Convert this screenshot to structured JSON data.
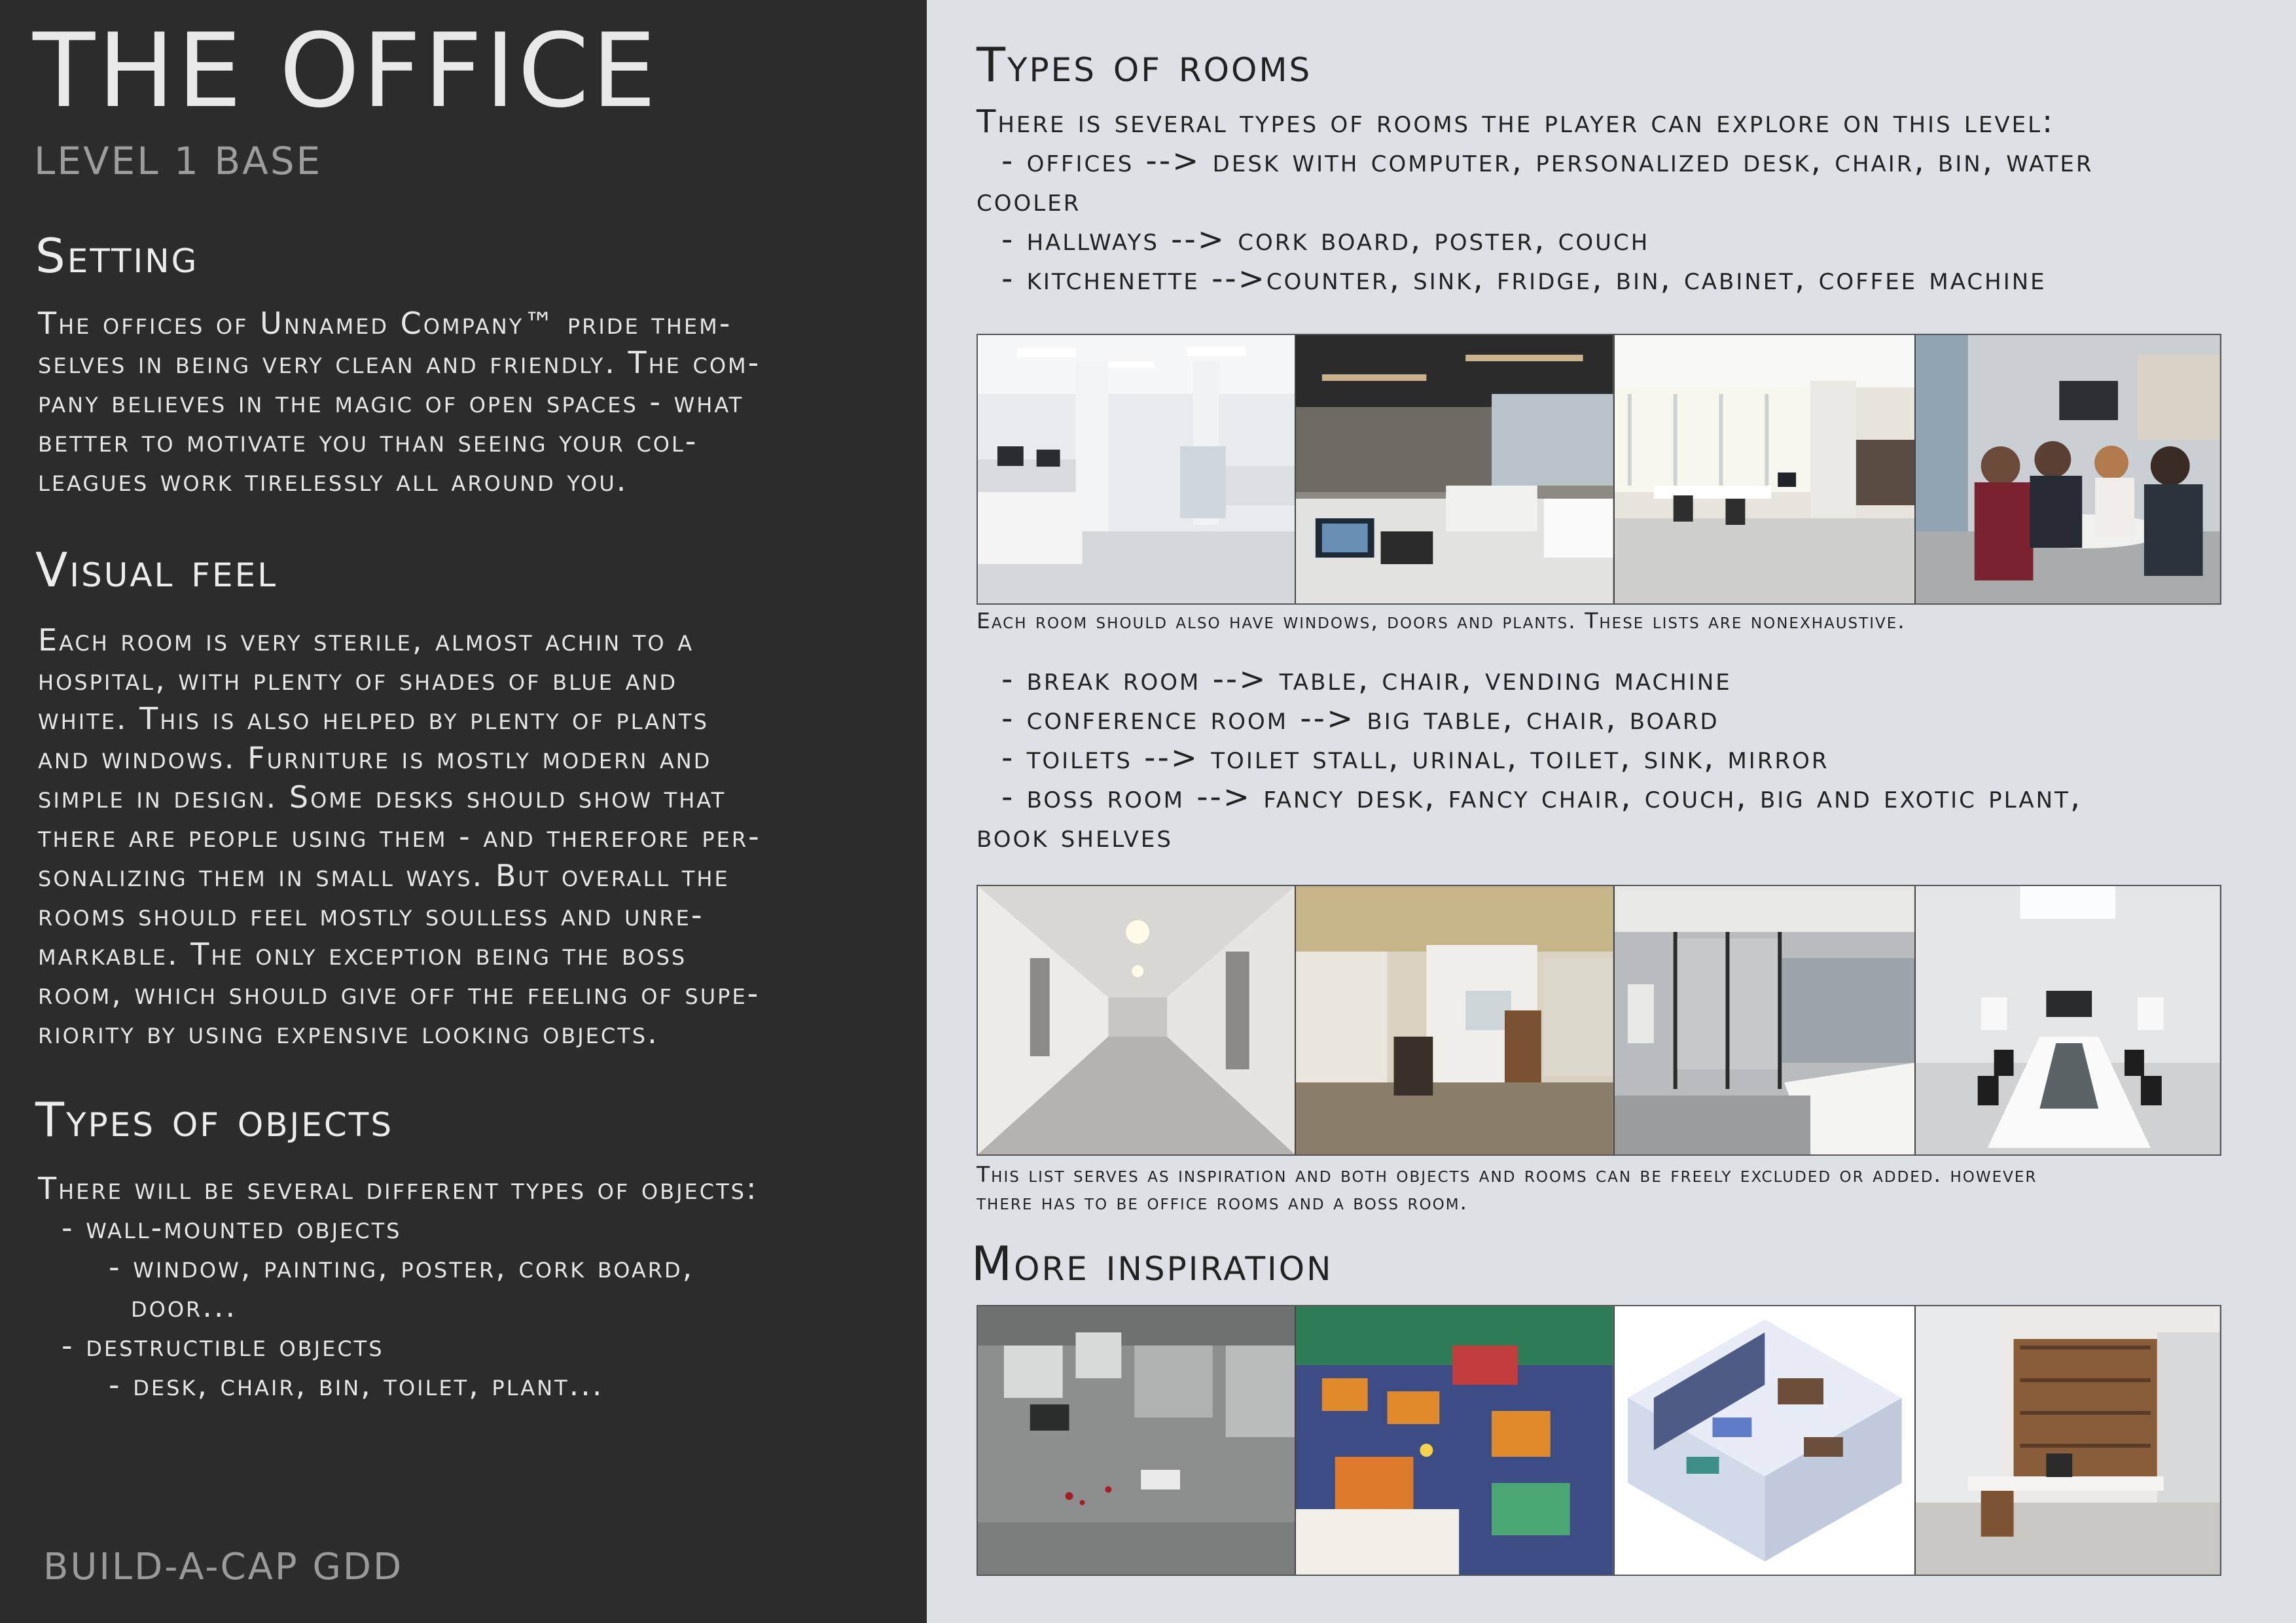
{
  "left": {
    "title": "THE OFFICE",
    "subtitle": "LEVEL 1 BASE",
    "setting": {
      "heading": "Setting",
      "lines": [
        "The offices of Unnamed Company™ pride them-",
        "selves in being very clean and friendly. The com-",
        "pany believes in the magic of open spaces - what",
        "better to motivate you than seeing your col-",
        "leagues work tirelessly all around you."
      ]
    },
    "visual": {
      "heading": "Visual feel",
      "lines": [
        "Each room is very sterile, almost achin to a",
        "hospital, with plenty of shades of blue and",
        "white. This is also helped by plenty of plants",
        "and windows. Furniture is mostly modern and",
        "simple in design. Some desks should show that",
        "there are people using them - and therefore per-",
        "sonalizing them in small ways. But overall the",
        "rooms should feel mostly soulless and unre-",
        "markable. The only exception being the boss",
        "room, which should give off the feeling of supe-",
        "riority by using expensive looking objects."
      ]
    },
    "objects": {
      "heading": "Types of objects",
      "intro": "There will be several different types of objects:",
      "wall_head": "- wall-mounted objects",
      "wall_items_1": "- window, painting, poster, cork board,",
      "wall_items_2": "door...",
      "destr_head": "- destructible objects",
      "destr_items": "- desk, chair, bin, toilet, plant..."
    },
    "footer": "BUILD-A-CAP GDD"
  },
  "right": {
    "rooms_heading": "Types of rooms",
    "rooms_intro": "There is several types of rooms the player can explore on this level:",
    "rooms_list_1": [
      "- offices --> desk with computer, personalized desk, chair, bin, water",
      "cooler",
      "- hallways --> cork board, poster, couch",
      "- kitchenette -->counter, sink, fridge, bin, cabinet, coffee machine"
    ],
    "caption_1": "Each room should also have windows, doors and plants. These lists are nonexhaustive.",
    "rooms_list_2": [
      "- break room --> table, chair, vending machine",
      "- conference room --> big table, chair, board",
      "- toilets --> toilet stall, urinal, toilet, sink, mirror",
      "- boss room --> fancy desk, fancy chair, couch, big and exotic plant,",
      "book shelves"
    ],
    "caption_2_l1": "This list serves as inspiration and both objects and rooms can be freely excluded or added. however",
    "caption_2_l2": "there has to be office rooms and a boss room.",
    "inspiration_heading": "More inspiration"
  },
  "images": {
    "row1": [
      "open-office-photo",
      "busy-office-photo",
      "sunny-office-photo",
      "break-meeting-photo"
    ],
    "row2": [
      "hallway-photo",
      "office-interior-photo",
      "toilets-photo",
      "conference-room-photo"
    ],
    "row3": [
      "game-office-topdown",
      "game-office-colorful",
      "isometric-office-illustration",
      "boss-office-render"
    ]
  }
}
